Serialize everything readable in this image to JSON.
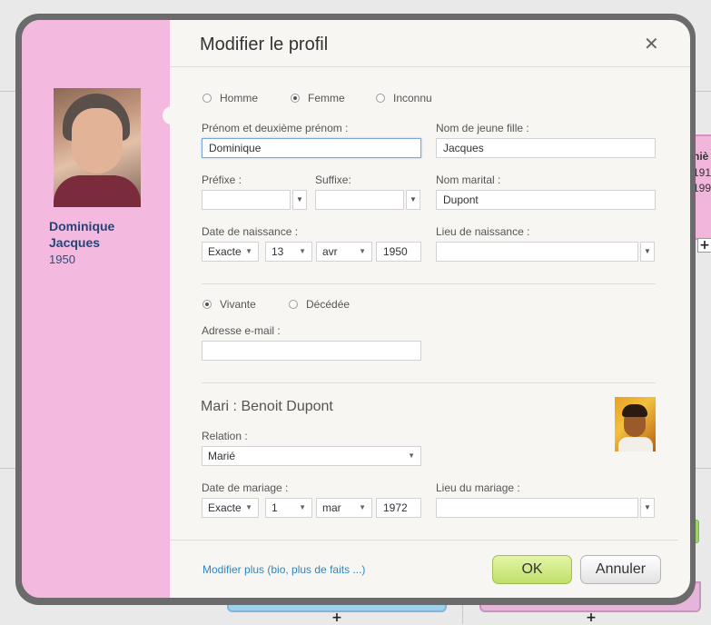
{
  "background": {
    "right_card": {
      "name_fragment": "niè",
      "year1": "191",
      "year2": "199"
    },
    "plus_symbol": "+"
  },
  "dialog": {
    "title": "Modifier le profil",
    "close_symbol": "✕",
    "sidebar": {
      "first_name": "Dominique",
      "last_name": "Jacques",
      "year": "1950"
    },
    "gender": {
      "options": [
        "Homme",
        "Femme",
        "Inconnu"
      ],
      "selected": "Femme"
    },
    "fields": {
      "first_names_label": "Prénom et deuxième prénom :",
      "first_names_value": "Dominique",
      "maiden_name_label": "Nom de jeune fille :",
      "maiden_name_value": "Jacques",
      "prefix_label": "Préfixe :",
      "suffix_label": "Suffixe:",
      "married_name_label": "Nom marital :",
      "married_name_value": "Dupont",
      "birth_date_label": "Date de naissance :",
      "birth_precision": "Exacte",
      "birth_day": "13",
      "birth_month": "avr",
      "birth_year": "1950",
      "birth_place_label": "Lieu de naissance :"
    },
    "status": {
      "options": [
        "Vivante",
        "Décédée"
      ],
      "selected": "Vivante"
    },
    "email_label": "Adresse e-mail :",
    "spouse": {
      "heading": "Mari : Benoit Dupont",
      "relation_label": "Relation :",
      "relation_value": "Marié",
      "marriage_date_label": "Date de mariage :",
      "marriage_precision": "Exacte",
      "marriage_day": "1",
      "marriage_month": "mar",
      "marriage_year": "1972",
      "marriage_place_label": "Lieu du mariage :"
    },
    "footer": {
      "more_link": "Modifier plus (bio, plus de faits ...)",
      "ok_label": "OK",
      "cancel_label": "Annuler"
    }
  },
  "icons": {
    "dropdown_arrow": "▼"
  },
  "colors": {
    "sidebar_pink": "#f3b9df",
    "ok_green": "#bfe06a",
    "link_blue": "#2e86c1",
    "name_blue": "#23467a"
  }
}
